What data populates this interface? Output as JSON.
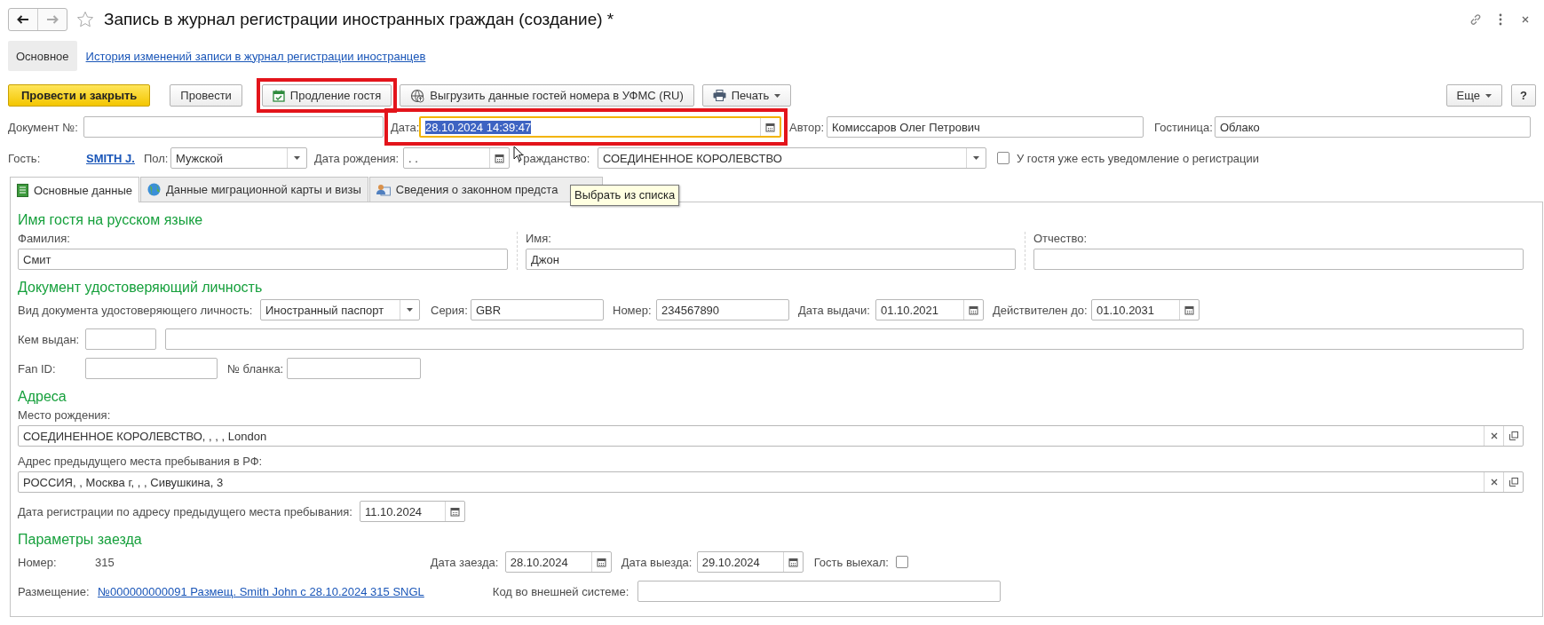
{
  "window": {
    "title": "Запись в журнал регистрации иностранных граждан (создание) *"
  },
  "nav": [
    {
      "label": "Основное",
      "selected": true
    },
    {
      "label": "История изменений записи в журнал регистрации иностранцев",
      "selected": false
    }
  ],
  "toolbar": {
    "buttons": [
      {
        "label": "Провести и закрыть",
        "kind": "primary",
        "highlighted": false
      },
      {
        "label": "Провести",
        "kind": "plain",
        "highlighted": false
      },
      {
        "label": "Продление гостя",
        "kind": "calendar",
        "highlighted": true
      },
      {
        "label": "Выгрузить данные гостей номера в УФМС (RU)",
        "kind": "upload",
        "highlighted": false
      },
      {
        "label": "Печать",
        "kind": "print",
        "highlighted": false
      }
    ],
    "right": [
      {
        "label": "Еще",
        "kind": "menu"
      },
      {
        "label": "?",
        "kind": "plain"
      }
    ]
  },
  "header_rows": [
    [
      {
        "kind": "text",
        "label": "Документ №:",
        "focused": false,
        "highlighted": false
      },
      {
        "kind": "datetime",
        "label": "Дата:",
        "value": "28.10.2024 14:39:47",
        "focused": true,
        "highlighted": true
      },
      {
        "kind": "text",
        "label": "Автор:",
        "value": "Комиссаров Олег Петрович",
        "focused": false,
        "highlighted": false
      },
      {
        "kind": "text",
        "label": "Гостиница:",
        "value": "Облако",
        "focused": false,
        "highlighted": false
      }
    ],
    [
      {
        "kind": "link",
        "label": "Гость:",
        "value": "SMITH J.",
        "bold": true
      },
      {
        "kind": "select",
        "label": "Пол:",
        "value": "Мужской"
      },
      {
        "kind": "date",
        "label": "Дата рождения:",
        "value": ".  ."
      },
      {
        "kind": "select",
        "label": "Гражданство:",
        "value": "СОЕДИНЕННОЕ КОРОЛЕВСТВО"
      },
      {
        "kind": "checkbox",
        "label": "У гостя уже есть уведомление о регистрации",
        "checked": false
      }
    ]
  ],
  "tabs": [
    {
      "label": "Основные данные",
      "selected": true
    },
    {
      "label": "Данные миграционной карты и визы",
      "selected": false
    },
    {
      "label": "Сведения о законном предста",
      "selected": false
    }
  ],
  "tooltip": {
    "text": "Выбрать из списка"
  },
  "sections": [
    {
      "heading": "Имя гостя на русском языке",
      "rows": [
        [
          {
            "kind": "stacked",
            "label": "Фамилия:",
            "value": "Смит"
          },
          {
            "kind": "stacked",
            "label": "Имя:",
            "value": "Джон"
          },
          {
            "kind": "stacked",
            "label": "Отчество:"
          }
        ]
      ]
    },
    {
      "heading": "Документ удостоверяющий личность",
      "rows": [
        [
          {
            "kind": "select",
            "label": "Вид документа удостоверяющего личность:",
            "value": "Иностранный паспорт"
          },
          {
            "kind": "text",
            "label": "Серия:",
            "value": "GBR"
          },
          {
            "kind": "text",
            "label": "Номер:",
            "value": "234567890"
          },
          {
            "kind": "date",
            "label": "Дата выдачи:",
            "value": "01.10.2021"
          },
          {
            "kind": "date",
            "label": "Действителен до:",
            "value": "01.10.2031"
          }
        ],
        [
          {
            "kind": "text",
            "label": "Кем выдан:"
          },
          {
            "kind": "text"
          }
        ],
        [
          {
            "kind": "text",
            "label": "Fan ID:"
          },
          {
            "kind": "text",
            "label": "№ бланка:"
          }
        ]
      ]
    },
    {
      "heading": "Адреса",
      "rows": [
        [
          {
            "kind": "address",
            "label": "Место рождения:",
            "value": "СОЕДИНЕННОЕ КОРОЛЕВСТВО, , , , London"
          }
        ],
        [
          {
            "kind": "address",
            "label": "Адрес предыдущего места пребывания в РФ:",
            "value": "РОССИЯ, , Москва г, , , Сивушкина, 3"
          }
        ],
        [
          {
            "kind": "date",
            "label": "Дата регистрации по адресу предыдущего места пребывания:",
            "value": "11.10.2024"
          }
        ]
      ]
    },
    {
      "heading": "Параметры заезда",
      "rows": [
        [
          {
            "kind": "static",
            "label": "Номер:",
            "value": "315"
          },
          {
            "kind": "date",
            "label": "Дата заезда:",
            "value": "28.10.2024"
          },
          {
            "kind": "date",
            "label": "Дата выезда:",
            "value": "29.10.2024"
          },
          {
            "kind": "flag",
            "label": "Гость выехал:",
            "checked": false
          }
        ],
        [
          {
            "kind": "link",
            "label": "Размещение:",
            "value": "№000000000091 Размещ. Smith John с 28.10.2024 315 SNGL",
            "bold": false
          },
          {
            "kind": "text",
            "label": "Код во внешней системе:"
          }
        ]
      ]
    }
  ]
}
